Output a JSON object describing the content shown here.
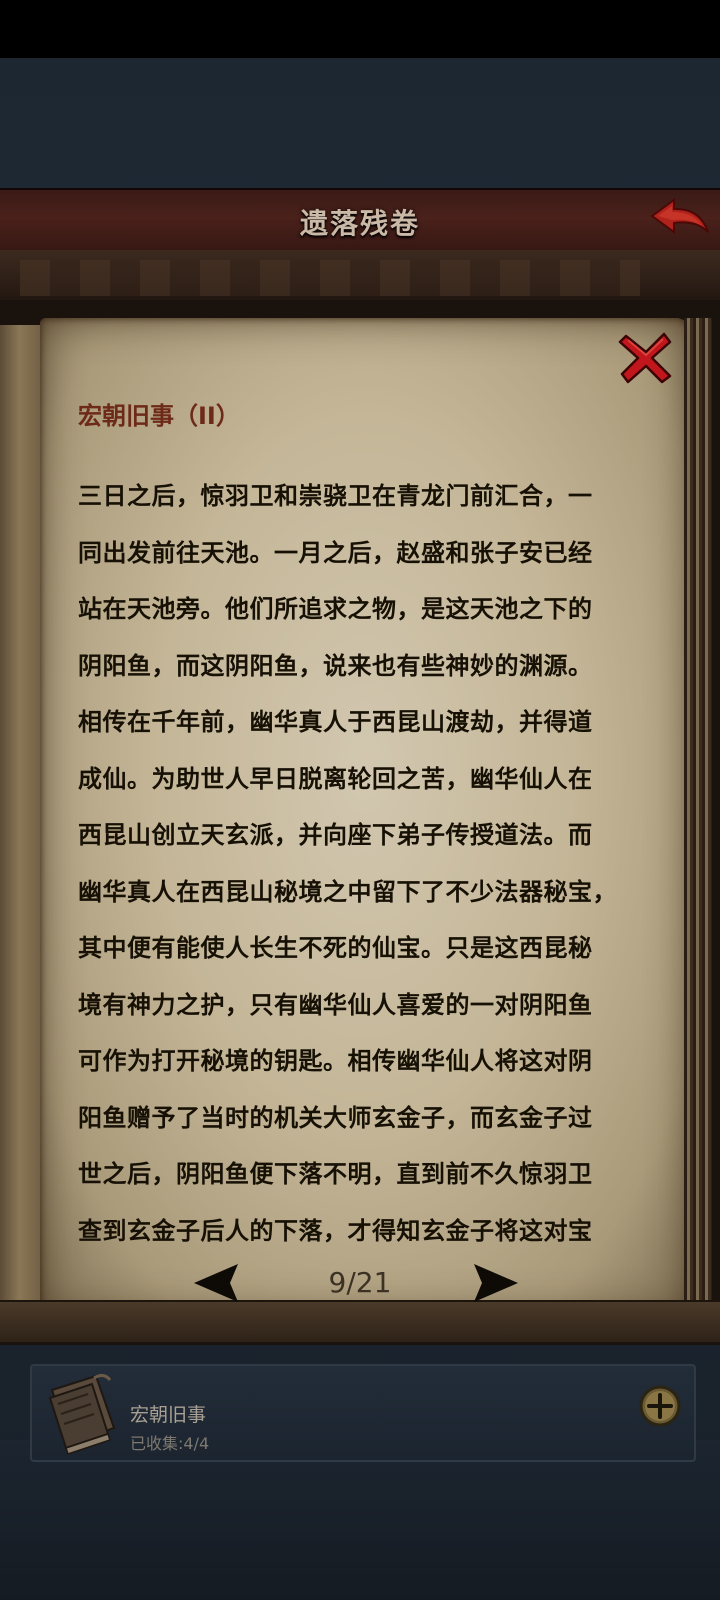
{
  "header": {
    "title": "遗落残卷"
  },
  "book": {
    "chapter_title": "宏朝旧事（II）",
    "lines": [
      "三日之后，惊羽卫和崇骁卫在青龙门前汇合，一",
      "同出发前往天池。一月之后，赵盛和张子安已经",
      "站在天池旁。他们所追求之物，是这天池之下的",
      "阴阳鱼，而这阴阳鱼，说来也有些神妙的渊源。",
      "相传在千年前，幽华真人于西昆山渡劫，并得道",
      "成仙。为助世人早日脱离轮回之苦，幽华仙人在",
      "西昆山创立天玄派，并向座下弟子传授道法。而",
      "幽华真人在西昆山秘境之中留下了不少法器秘宝，",
      "其中便有能使人长生不死的仙宝。只是这西昆秘",
      "境有神力之护，只有幽华仙人喜爱的一对阴阳鱼",
      "可作为打开秘境的钥匙。相传幽华仙人将这对阴",
      "阳鱼赠予了当时的机关大师玄金子，而玄金子过",
      "世之后，阴阳鱼便下落不明，直到前不久惊羽卫",
      "查到玄金子后人的下落，才得知玄金子将这对宝"
    ],
    "page_indicator": "9/21"
  },
  "collection": {
    "name": "宏朝旧事",
    "count_label": "已收集:4/4"
  },
  "colors": {
    "title_bar": "#4a211b",
    "parchment": "#c4b697",
    "chapter_title": "#6e2a18",
    "close_red": "#c0161c"
  },
  "icons": {
    "back": "back-arrow-icon",
    "close": "close-x-icon",
    "prev": "left-triangle-icon",
    "next": "right-triangle-icon",
    "add": "plus-circle-icon",
    "book": "book-icon"
  }
}
